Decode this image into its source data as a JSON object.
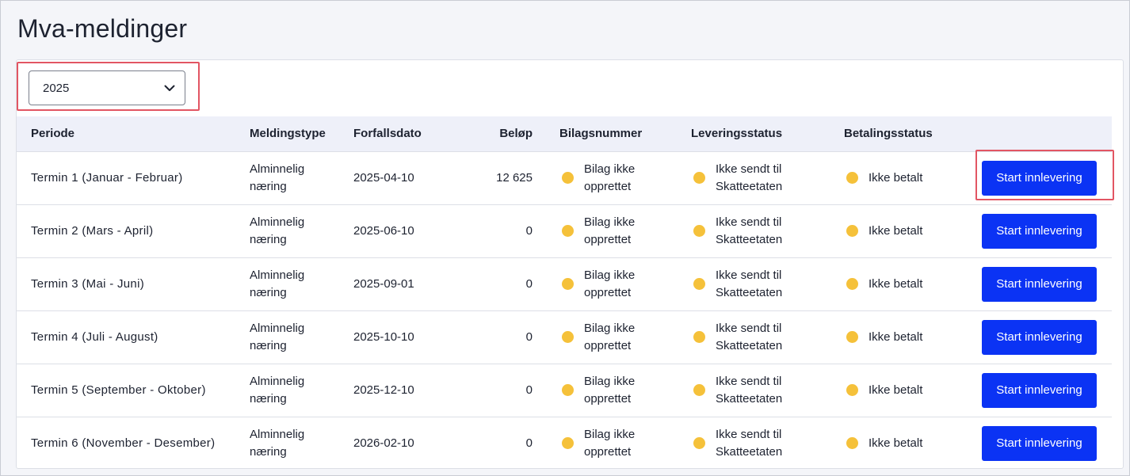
{
  "page": {
    "title": "Mva-meldinger"
  },
  "filter": {
    "year_selected": "2025",
    "chevron_icon": "chevron-down-icon"
  },
  "table": {
    "headers": {
      "periode": "Periode",
      "meldingstype": "Meldingstype",
      "forfallsdato": "Forfallsdato",
      "belop": "Beløp",
      "bilagsnummer": "Bilagsnummer",
      "leveringsstatus": "Leveringsstatus",
      "betalingsstatus": "Betalingsstatus"
    },
    "status_color": "#f5c13a",
    "button_color": "#0b33f4",
    "rows": [
      {
        "periode": "Termin 1 (Januar - Februar)",
        "meldingstype_1": "Alminnelig",
        "meldingstype_2": "næring",
        "forfallsdato": "2025-04-10",
        "belop": "12 625",
        "bilag_1": "Bilag ikke",
        "bilag_2": "opprettet",
        "levering_1": "Ikke sendt til",
        "levering_2": "Skatteetaten",
        "betaling": "Ikke betalt",
        "action": "Start innlevering"
      },
      {
        "periode": "Termin 2 (Mars - April)",
        "meldingstype_1": "Alminnelig",
        "meldingstype_2": "næring",
        "forfallsdato": "2025-06-10",
        "belop": "0",
        "bilag_1": "Bilag ikke",
        "bilag_2": "opprettet",
        "levering_1": "Ikke sendt til",
        "levering_2": "Skatteetaten",
        "betaling": "Ikke betalt",
        "action": "Start innlevering"
      },
      {
        "periode": "Termin 3 (Mai - Juni)",
        "meldingstype_1": "Alminnelig",
        "meldingstype_2": "næring",
        "forfallsdato": "2025-09-01",
        "belop": "0",
        "bilag_1": "Bilag ikke",
        "bilag_2": "opprettet",
        "levering_1": "Ikke sendt til",
        "levering_2": "Skatteetaten",
        "betaling": "Ikke betalt",
        "action": "Start innlevering"
      },
      {
        "periode": "Termin 4 (Juli - August)",
        "meldingstype_1": "Alminnelig",
        "meldingstype_2": "næring",
        "forfallsdato": "2025-10-10",
        "belop": "0",
        "bilag_1": "Bilag ikke",
        "bilag_2": "opprettet",
        "levering_1": "Ikke sendt til",
        "levering_2": "Skatteetaten",
        "betaling": "Ikke betalt",
        "action": "Start innlevering"
      },
      {
        "periode": "Termin 5 (September - Oktober)",
        "meldingstype_1": "Alminnelig",
        "meldingstype_2": "næring",
        "forfallsdato": "2025-12-10",
        "belop": "0",
        "bilag_1": "Bilag ikke",
        "bilag_2": "opprettet",
        "levering_1": "Ikke sendt til",
        "levering_2": "Skatteetaten",
        "betaling": "Ikke betalt",
        "action": "Start innlevering"
      },
      {
        "periode": "Termin 6 (November - Desember)",
        "meldingstype_1": "Alminnelig",
        "meldingstype_2": "næring",
        "forfallsdato": "2026-02-10",
        "belop": "0",
        "bilag_1": "Bilag ikke",
        "bilag_2": "opprettet",
        "levering_1": "Ikke sendt til",
        "levering_2": "Skatteetaten",
        "betaling": "Ikke betalt",
        "action": "Start innlevering"
      }
    ]
  }
}
